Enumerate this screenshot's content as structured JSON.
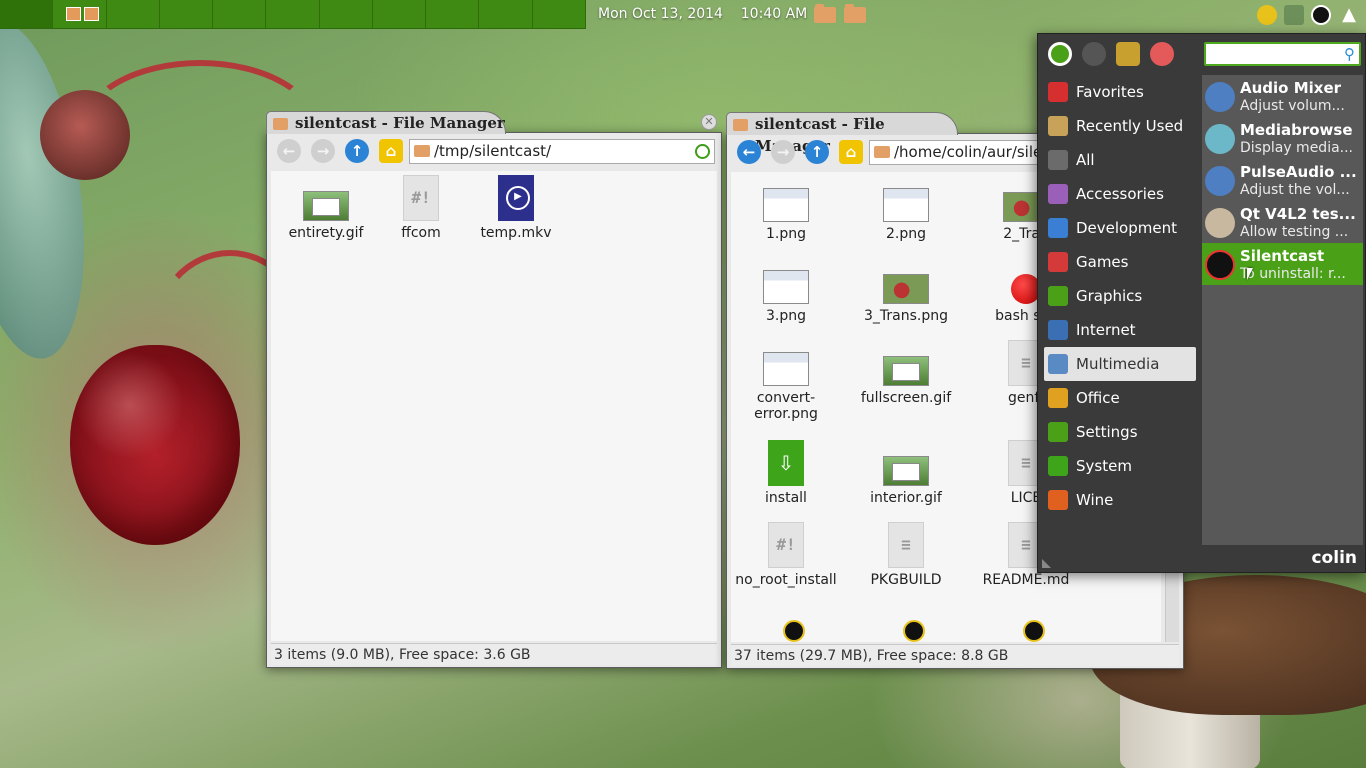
{
  "panel": {
    "clock": "Mon Oct 13, 2014    10:40 AM",
    "workspace_count": 11
  },
  "windows": [
    {
      "title": "silentcast - File Manager",
      "path": "/tmp/silentcast/",
      "status": "3 items (9.0 MB), Free space: 3.6 GB",
      "files": [
        {
          "name": "entirety.gif",
          "icon": "gif-thumbnail-icon"
        },
        {
          "name": "ffcom",
          "icon": "script-file-icon"
        },
        {
          "name": "temp.mkv",
          "icon": "video-file-icon"
        }
      ]
    },
    {
      "title": "silentcast - File Manager",
      "path": "/home/colin/aur/sile",
      "status": "37 items (29.7 MB), Free space: 8.8 GB",
      "files": [
        {
          "name": "1.png",
          "icon": "screenshot-thumbnail-icon"
        },
        {
          "name": "2.png",
          "icon": "screenshot-thumbnail-icon"
        },
        {
          "name": "2_Tran",
          "icon": "photo-thumbnail-icon"
        },
        {
          "name": "3.png",
          "icon": "screenshot-thumbnail-icon"
        },
        {
          "name": "3_Trans.png",
          "icon": "photo-thumbnail-icon"
        },
        {
          "name": "bash sile",
          "icon": "red-ball-icon"
        },
        {
          "name": "convert-\nerror.png",
          "icon": "screenshot-thumbnail-icon"
        },
        {
          "name": "fullscreen.gif",
          "icon": "gif-thumbnail-icon"
        },
        {
          "name": "genff",
          "icon": "text-file-icon"
        },
        {
          "name": "install",
          "icon": "install-script-icon"
        },
        {
          "name": "interior.gif",
          "icon": "gif-thumbnail-icon"
        },
        {
          "name": "LICE",
          "icon": "text-file-icon"
        },
        {
          "name": "no_root_install",
          "icon": "script-file-icon"
        },
        {
          "name": "PKGBUILD",
          "icon": "text-file-icon"
        },
        {
          "name": "README.md",
          "icon": "text-file-icon"
        }
      ]
    }
  ],
  "menu": {
    "categories": [
      {
        "label": "Favorites",
        "icon": "bookmark-icon",
        "color": "#d62f2f"
      },
      {
        "label": "Recently Used",
        "icon": "recent-folder-icon",
        "color": "#c9a25a"
      },
      {
        "label": "All",
        "icon": "all-apps-icon",
        "color": "#6b6b6b"
      },
      {
        "label": "Accessories",
        "icon": "accessories-icon",
        "color": "#9a5fb8"
      },
      {
        "label": "Development",
        "icon": "wrench-icon",
        "color": "#3a7fd4"
      },
      {
        "label": "Games",
        "icon": "gamepad-icon",
        "color": "#d43a3a"
      },
      {
        "label": "Graphics",
        "icon": "graphics-icon",
        "color": "#4aa017"
      },
      {
        "label": "Internet",
        "icon": "globe-icon",
        "color": "#3a6fb4"
      },
      {
        "label": "Multimedia",
        "icon": "music-note-icon",
        "color": "#5a8ac4"
      },
      {
        "label": "Office",
        "icon": "document-icon",
        "color": "#e0a020"
      },
      {
        "label": "Settings",
        "icon": "toggle-icon",
        "color": "#4aa017"
      },
      {
        "label": "System",
        "icon": "info-icon",
        "color": "#3ea51b"
      },
      {
        "label": "Wine",
        "icon": "wine-icon",
        "color": "#e06020"
      }
    ],
    "selected_category": "Multimedia",
    "apps": [
      {
        "name": "Audio Mixer",
        "desc": "Adjust volum...",
        "icon": "speaker-icon",
        "color": "#4d7fc2"
      },
      {
        "name": "Mediabrowse",
        "desc": "Display media...",
        "icon": "monitor-icon",
        "color": "#6cb8c8"
      },
      {
        "name": "PulseAudio ...",
        "desc": "Adjust the vol...",
        "icon": "speaker-icon",
        "color": "#4d7fc2"
      },
      {
        "name": "Qt V4L2 tes...",
        "desc": "Allow testing ...",
        "icon": "webcam-icon",
        "color": "#c8b8a0"
      },
      {
        "name": "Silentcast",
        "desc": "To uninstall: r...",
        "icon": "silentcast-icon",
        "color": "#111111"
      }
    ],
    "username": "colin"
  }
}
